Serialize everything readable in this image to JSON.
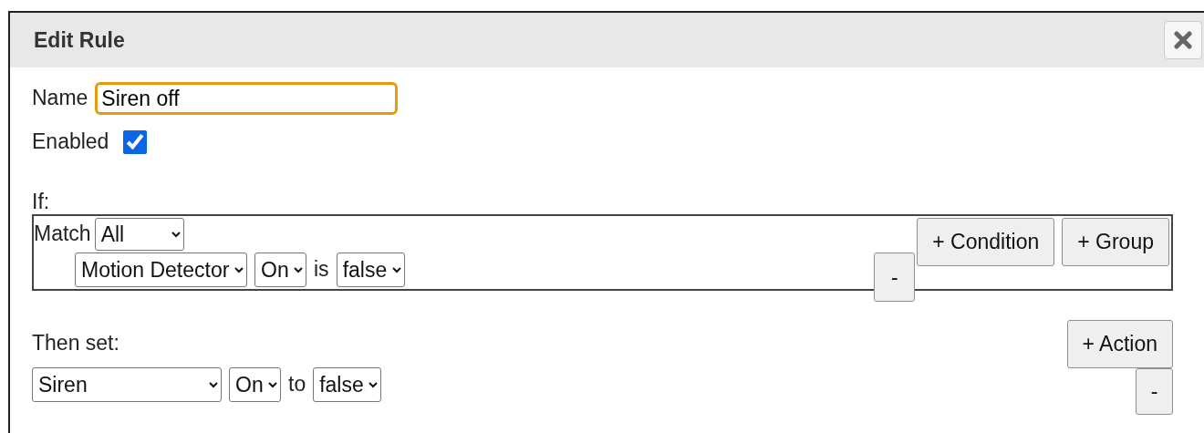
{
  "title": "Edit Rule",
  "name_field": {
    "label": "Name",
    "value": "Siren off",
    "focused": true
  },
  "enabled": {
    "label": "Enabled",
    "checked": true
  },
  "if_section": {
    "label": "If:",
    "match": {
      "label": "Match",
      "value": "All"
    },
    "conditions": [
      {
        "device": "Motion Detector",
        "property": "On",
        "operator": "is",
        "value": "false"
      }
    ],
    "buttons": [
      "+ Condition",
      "+ Group"
    ],
    "remove_button": "-"
  },
  "then_section": {
    "label": "Then set:",
    "actions": [
      {
        "device": "Siren",
        "property": "On",
        "connector": "to",
        "value": "false"
      }
    ],
    "add_button": "+ Action",
    "remove_button": "-"
  }
}
